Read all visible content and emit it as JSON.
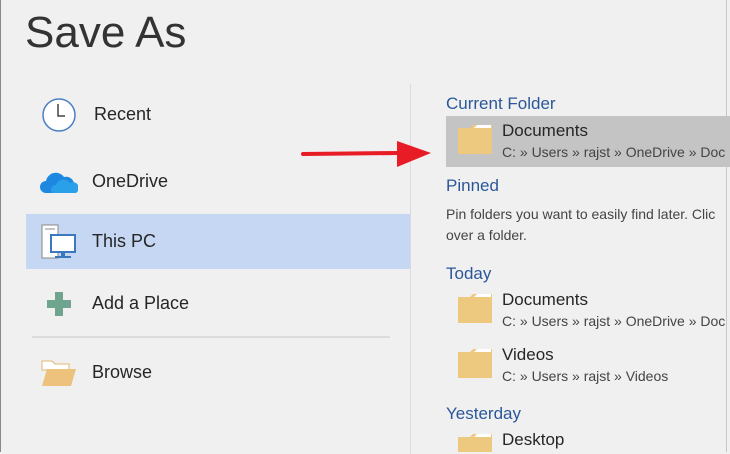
{
  "title": "Save As",
  "nav": [
    {
      "label": "Recent",
      "icon": "clock-icon"
    },
    {
      "label": "OneDrive",
      "icon": "cloud-icon"
    },
    {
      "label": "This PC",
      "icon": "computer-icon",
      "selected": true
    },
    {
      "label": "Add a Place",
      "icon": "plus-icon"
    },
    {
      "label": "Browse",
      "icon": "folder-open-icon"
    }
  ],
  "sections": {
    "current": "Current Folder",
    "pinned": "Pinned",
    "today": "Today",
    "yesterday": "Yesterday"
  },
  "current_folder": {
    "name": "Documents",
    "path": "C: » Users » rajst » OneDrive » Doc"
  },
  "pinned_hint": [
    "Pin folders you want to easily find later. Clic",
    "over a folder."
  ],
  "today": [
    {
      "name": "Documents",
      "path": "C: » Users » rajst » OneDrive » Doc"
    },
    {
      "name": "Videos",
      "path": "C: » Users » rajst » Videos"
    }
  ],
  "yesterday": [
    {
      "name": "Desktop"
    }
  ],
  "colors": {
    "accent": "#2b579a",
    "selected": "#c5d7f2",
    "arrow": "#e81c24",
    "folder": "#f0c87d"
  }
}
